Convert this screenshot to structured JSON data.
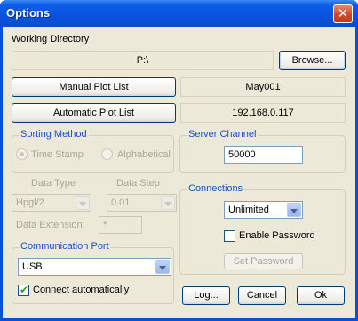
{
  "window": {
    "title": "Options"
  },
  "working_directory": {
    "label": "Working Directory",
    "path": "P:\\",
    "browse_label": "Browse..."
  },
  "plot_lists": {
    "manual_label": "Manual Plot List",
    "manual_value": "May001",
    "automatic_label": "Automatic Plot List",
    "automatic_value": "192.168.0.117"
  },
  "sorting": {
    "title": "Sorting Method",
    "options": [
      "Time Stamp",
      "Alphabetical"
    ],
    "selected": "Time Stamp"
  },
  "server_channel": {
    "title": "Server Channel",
    "value": "50000"
  },
  "data": {
    "type_label": "Data Type",
    "type_value": "Hpgl/2",
    "step_label": "Data Step",
    "step_value": "0.01",
    "extension_label": "Data Extension:",
    "extension_value": "*"
  },
  "connections": {
    "title": "Connections",
    "value": "Unlimited",
    "enable_password_label": "Enable Password",
    "enable_password_checked": false,
    "set_password_label": "Set Password"
  },
  "communication_port": {
    "title": "Communication Port",
    "value": "USB",
    "connect_auto_label": "Connect automatically",
    "connect_auto_checked": true
  },
  "footer": {
    "log_label": "Log...",
    "cancel_label": "Cancel",
    "ok_label": "Ok"
  }
}
